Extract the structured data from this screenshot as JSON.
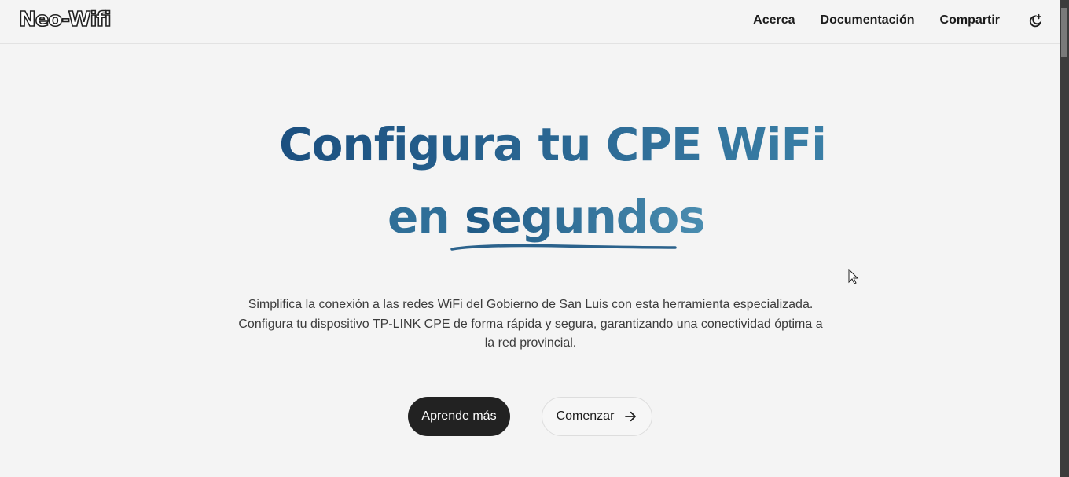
{
  "header": {
    "logo": "Neo-Wifi",
    "nav": [
      "Acerca",
      "Documentación",
      "Compartir"
    ],
    "theme_icon": "moon-icon"
  },
  "hero": {
    "title_line1": "Configura tu CPE WiFi",
    "title_en": "en",
    "title_highlight": "segundos",
    "description": "Simplifica la conexión a las redes WiFi del Gobierno de San Luis con esta herramienta especializada. Configura tu dispositivo TP-LINK CPE de forma rápida y segura, garantizando una conectividad óptima a la red provincial.",
    "primary_button": "Aprende más",
    "secondary_button": "Comenzar"
  }
}
